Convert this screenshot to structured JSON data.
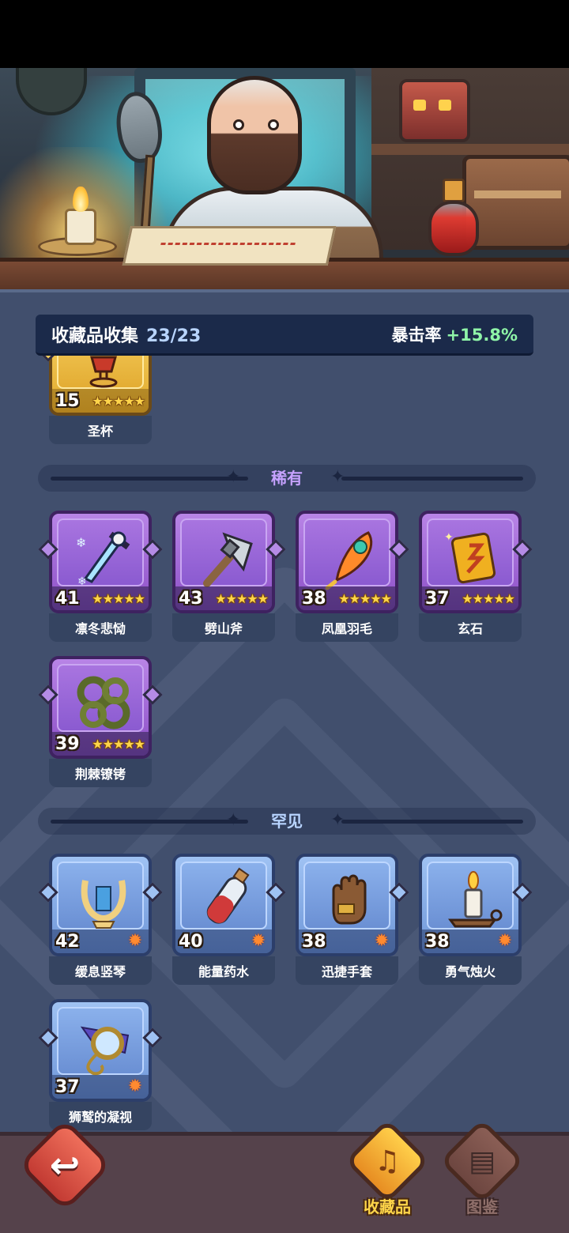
{
  "collection": {
    "label": "收藏品收集",
    "count": "23/23",
    "stat_label": "暴击率",
    "stat_value": "+15.8%"
  },
  "sections": {
    "rare_title": "稀有",
    "uncommon_title": "罕见"
  },
  "legendary_items": [
    {
      "name": "圣杯",
      "level": "15",
      "stars": "★★★★★",
      "icon": "chalice-icon"
    }
  ],
  "rare_items": [
    {
      "name": "凛冬悲恸",
      "level": "41",
      "stars": "★★★★★",
      "icon": "frost-dagger-icon"
    },
    {
      "name": "劈山斧",
      "level": "43",
      "stars": "★★★★★",
      "icon": "axe-icon"
    },
    {
      "name": "凤凰羽毛",
      "level": "38",
      "stars": "★★★★★",
      "icon": "phoenix-feather-icon"
    },
    {
      "name": "玄石",
      "level": "37",
      "stars": "★★★★★",
      "icon": "rune-stone-icon"
    },
    {
      "name": "荆棘镣铐",
      "level": "39",
      "stars": "★★★★★",
      "icon": "thorn-shackles-icon"
    }
  ],
  "uncommon_items": [
    {
      "name": "缓息竖琴",
      "level": "42",
      "icon": "lyre-icon"
    },
    {
      "name": "能量药水",
      "level": "40",
      "icon": "potion-icon"
    },
    {
      "name": "迅捷手套",
      "level": "38",
      "icon": "glove-icon"
    },
    {
      "name": "勇气烛火",
      "level": "38",
      "icon": "candle-icon"
    },
    {
      "name": "狮鹫的凝视",
      "level": "37",
      "icon": "monocle-icon"
    }
  ],
  "nav": {
    "collection_label": "收藏品",
    "codex_label": "图鉴",
    "back_icon": "back-arrow-icon"
  },
  "colors": {
    "panel_bg": "#414f6d",
    "rare_accent": "#b884e6",
    "uncommon_accent": "#9fc2f3",
    "legendary_accent": "#f6cf5e",
    "stat_green": "#8ff5a8"
  }
}
